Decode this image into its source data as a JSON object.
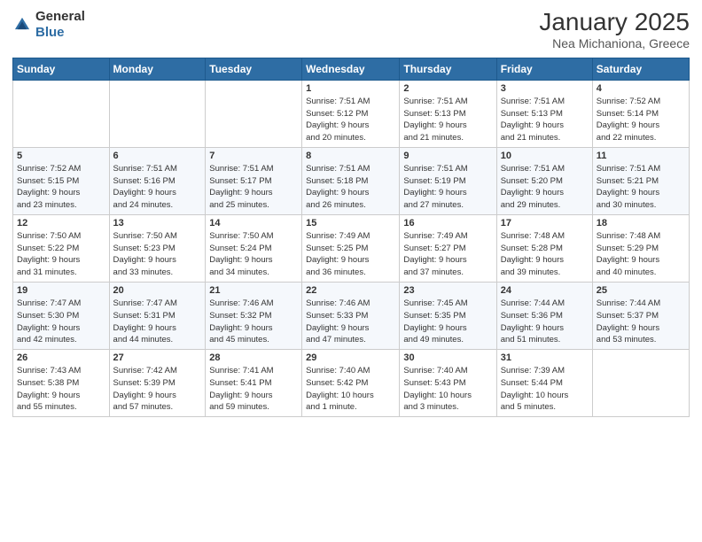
{
  "header": {
    "logo_general": "General",
    "logo_blue": "Blue",
    "title": "January 2025",
    "subtitle": "Nea Michaniona, Greece"
  },
  "weekdays": [
    "Sunday",
    "Monday",
    "Tuesday",
    "Wednesday",
    "Thursday",
    "Friday",
    "Saturday"
  ],
  "weeks": [
    [
      {
        "day": "",
        "info": ""
      },
      {
        "day": "",
        "info": ""
      },
      {
        "day": "",
        "info": ""
      },
      {
        "day": "1",
        "info": "Sunrise: 7:51 AM\nSunset: 5:12 PM\nDaylight: 9 hours\nand 20 minutes."
      },
      {
        "day": "2",
        "info": "Sunrise: 7:51 AM\nSunset: 5:13 PM\nDaylight: 9 hours\nand 21 minutes."
      },
      {
        "day": "3",
        "info": "Sunrise: 7:51 AM\nSunset: 5:13 PM\nDaylight: 9 hours\nand 21 minutes."
      },
      {
        "day": "4",
        "info": "Sunrise: 7:52 AM\nSunset: 5:14 PM\nDaylight: 9 hours\nand 22 minutes."
      }
    ],
    [
      {
        "day": "5",
        "info": "Sunrise: 7:52 AM\nSunset: 5:15 PM\nDaylight: 9 hours\nand 23 minutes."
      },
      {
        "day": "6",
        "info": "Sunrise: 7:51 AM\nSunset: 5:16 PM\nDaylight: 9 hours\nand 24 minutes."
      },
      {
        "day": "7",
        "info": "Sunrise: 7:51 AM\nSunset: 5:17 PM\nDaylight: 9 hours\nand 25 minutes."
      },
      {
        "day": "8",
        "info": "Sunrise: 7:51 AM\nSunset: 5:18 PM\nDaylight: 9 hours\nand 26 minutes."
      },
      {
        "day": "9",
        "info": "Sunrise: 7:51 AM\nSunset: 5:19 PM\nDaylight: 9 hours\nand 27 minutes."
      },
      {
        "day": "10",
        "info": "Sunrise: 7:51 AM\nSunset: 5:20 PM\nDaylight: 9 hours\nand 29 minutes."
      },
      {
        "day": "11",
        "info": "Sunrise: 7:51 AM\nSunset: 5:21 PM\nDaylight: 9 hours\nand 30 minutes."
      }
    ],
    [
      {
        "day": "12",
        "info": "Sunrise: 7:50 AM\nSunset: 5:22 PM\nDaylight: 9 hours\nand 31 minutes."
      },
      {
        "day": "13",
        "info": "Sunrise: 7:50 AM\nSunset: 5:23 PM\nDaylight: 9 hours\nand 33 minutes."
      },
      {
        "day": "14",
        "info": "Sunrise: 7:50 AM\nSunset: 5:24 PM\nDaylight: 9 hours\nand 34 minutes."
      },
      {
        "day": "15",
        "info": "Sunrise: 7:49 AM\nSunset: 5:25 PM\nDaylight: 9 hours\nand 36 minutes."
      },
      {
        "day": "16",
        "info": "Sunrise: 7:49 AM\nSunset: 5:27 PM\nDaylight: 9 hours\nand 37 minutes."
      },
      {
        "day": "17",
        "info": "Sunrise: 7:48 AM\nSunset: 5:28 PM\nDaylight: 9 hours\nand 39 minutes."
      },
      {
        "day": "18",
        "info": "Sunrise: 7:48 AM\nSunset: 5:29 PM\nDaylight: 9 hours\nand 40 minutes."
      }
    ],
    [
      {
        "day": "19",
        "info": "Sunrise: 7:47 AM\nSunset: 5:30 PM\nDaylight: 9 hours\nand 42 minutes."
      },
      {
        "day": "20",
        "info": "Sunrise: 7:47 AM\nSunset: 5:31 PM\nDaylight: 9 hours\nand 44 minutes."
      },
      {
        "day": "21",
        "info": "Sunrise: 7:46 AM\nSunset: 5:32 PM\nDaylight: 9 hours\nand 45 minutes."
      },
      {
        "day": "22",
        "info": "Sunrise: 7:46 AM\nSunset: 5:33 PM\nDaylight: 9 hours\nand 47 minutes."
      },
      {
        "day": "23",
        "info": "Sunrise: 7:45 AM\nSunset: 5:35 PM\nDaylight: 9 hours\nand 49 minutes."
      },
      {
        "day": "24",
        "info": "Sunrise: 7:44 AM\nSunset: 5:36 PM\nDaylight: 9 hours\nand 51 minutes."
      },
      {
        "day": "25",
        "info": "Sunrise: 7:44 AM\nSunset: 5:37 PM\nDaylight: 9 hours\nand 53 minutes."
      }
    ],
    [
      {
        "day": "26",
        "info": "Sunrise: 7:43 AM\nSunset: 5:38 PM\nDaylight: 9 hours\nand 55 minutes."
      },
      {
        "day": "27",
        "info": "Sunrise: 7:42 AM\nSunset: 5:39 PM\nDaylight: 9 hours\nand 57 minutes."
      },
      {
        "day": "28",
        "info": "Sunrise: 7:41 AM\nSunset: 5:41 PM\nDaylight: 9 hours\nand 59 minutes."
      },
      {
        "day": "29",
        "info": "Sunrise: 7:40 AM\nSunset: 5:42 PM\nDaylight: 10 hours\nand 1 minute."
      },
      {
        "day": "30",
        "info": "Sunrise: 7:40 AM\nSunset: 5:43 PM\nDaylight: 10 hours\nand 3 minutes."
      },
      {
        "day": "31",
        "info": "Sunrise: 7:39 AM\nSunset: 5:44 PM\nDaylight: 10 hours\nand 5 minutes."
      },
      {
        "day": "",
        "info": ""
      }
    ]
  ]
}
